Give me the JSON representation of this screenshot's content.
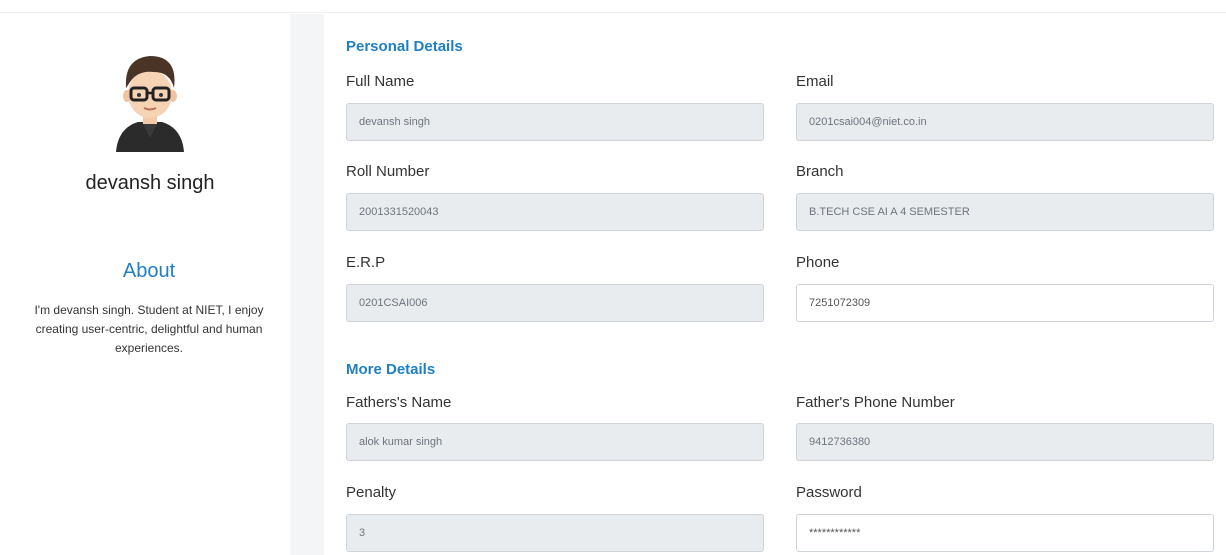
{
  "profile": {
    "name": "devansh singh",
    "about_title": "About",
    "about_text": "I'm devansh singh. Student at NIET, I enjoy creating user-centric, delightful and human experiences."
  },
  "personal_details": {
    "title": "Personal Details",
    "full_name": {
      "label": "Full Name",
      "value": "devansh singh"
    },
    "email": {
      "label": "Email",
      "value": "0201csai004@niet.co.in"
    },
    "roll_number": {
      "label": "Roll Number",
      "value": "2001331520043"
    },
    "branch": {
      "label": "Branch",
      "value": "B.TECH CSE AI A 4 SEMESTER"
    },
    "erp": {
      "label": "E.R.P",
      "value": "0201CSAI006"
    },
    "phone": {
      "label": "Phone",
      "value": "7251072309"
    }
  },
  "more_details": {
    "title": "More Details",
    "fathers_name": {
      "label": "Fathers's Name",
      "value": "alok kumar singh"
    },
    "fathers_phone": {
      "label": "Father's Phone Number",
      "value": "9412736380"
    },
    "penalty": {
      "label": "Penalty",
      "value": "3"
    },
    "password": {
      "label": "Password",
      "value": "************"
    }
  },
  "colors": {
    "accent": "#1f7fc6",
    "disabled_field": "#e9ecef",
    "gutter": "#f4f5f7"
  },
  "icons": {
    "avatar": "user-avatar-icon"
  }
}
